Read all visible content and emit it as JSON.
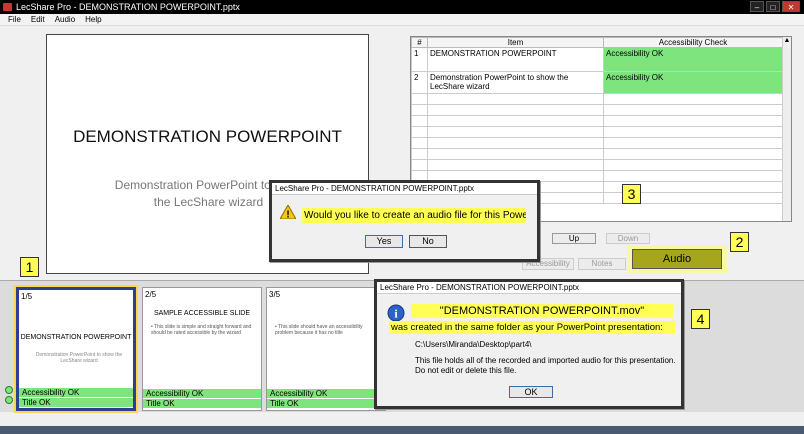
{
  "window": {
    "title": "LecShare Pro - DEMONSTRATION POWERPOINT.pptx"
  },
  "menu": {
    "items": [
      "File",
      "Edit",
      "Audio",
      "Help"
    ]
  },
  "slide": {
    "title": "DEMONSTRATION POWERPOINT",
    "subtitle_line1": "Demonstration PowerPoint to show",
    "subtitle_line2": "the LecShare wizard"
  },
  "table": {
    "headers": [
      "#",
      "Item",
      "Accessibility Check"
    ],
    "rows": [
      {
        "num": "1",
        "item": "DEMONSTRATION POWERPOINT",
        "check": "Accessibility OK"
      },
      {
        "num": "2",
        "item": "Demonstration PowerPoint to show the LecShare wizard",
        "check": "Accessibility OK"
      }
    ]
  },
  "buttons": {
    "up": "Up",
    "down": "Down",
    "accessibility": "Accessibility",
    "notes": "Notes",
    "audio": "Audio"
  },
  "callouts": [
    "1",
    "2",
    "3",
    "4"
  ],
  "thumbnails": [
    {
      "num": "1/5",
      "title": "DEMONSTRATION POWERPOINT",
      "sub": "Demonstration PowerPoint to show the LecShare wizard",
      "status1": "Accessibility OK",
      "status2": "Title OK"
    },
    {
      "num": "2/5",
      "title": "SAMPLE ACCESSIBLE SLIDE",
      "sub": "• This slide is simple and straight forward and should be rated accessible by the wizard",
      "status1": "Accessibility OK",
      "status2": "Title OK"
    },
    {
      "num": "3/5",
      "title": "",
      "sub": "• This slide should have an accessibility problem because it has no title",
      "status1": "Accessibility OK",
      "status2": "Title OK"
    }
  ],
  "dialog_audio": {
    "title": "LecShare Pro - DEMONSTRATION POWERPOINT.pptx",
    "message": "Would you like to create an audio file for this PowerPoint presentation?",
    "yes": "Yes",
    "no": "No"
  },
  "dialog_created": {
    "title": "LecShare Pro - DEMONSTRATION POWERPOINT.pptx",
    "filename": "\"DEMONSTRATION POWERPOINT.mov\"",
    "message": "was created in the same folder as your PowerPoint presentation:",
    "path": "C:\\Users\\Miranda\\Desktop\\part4\\",
    "note": "This file holds all of the recorded and imported audio for this presentation.  Do not edit or delete this file.",
    "ok": "OK"
  },
  "colors": {
    "ok_green": "#7ee57e",
    "highlight_yellow": "#ffff55",
    "audio_btn": "#a6a61c",
    "selected_border": "#2e3f8f"
  }
}
